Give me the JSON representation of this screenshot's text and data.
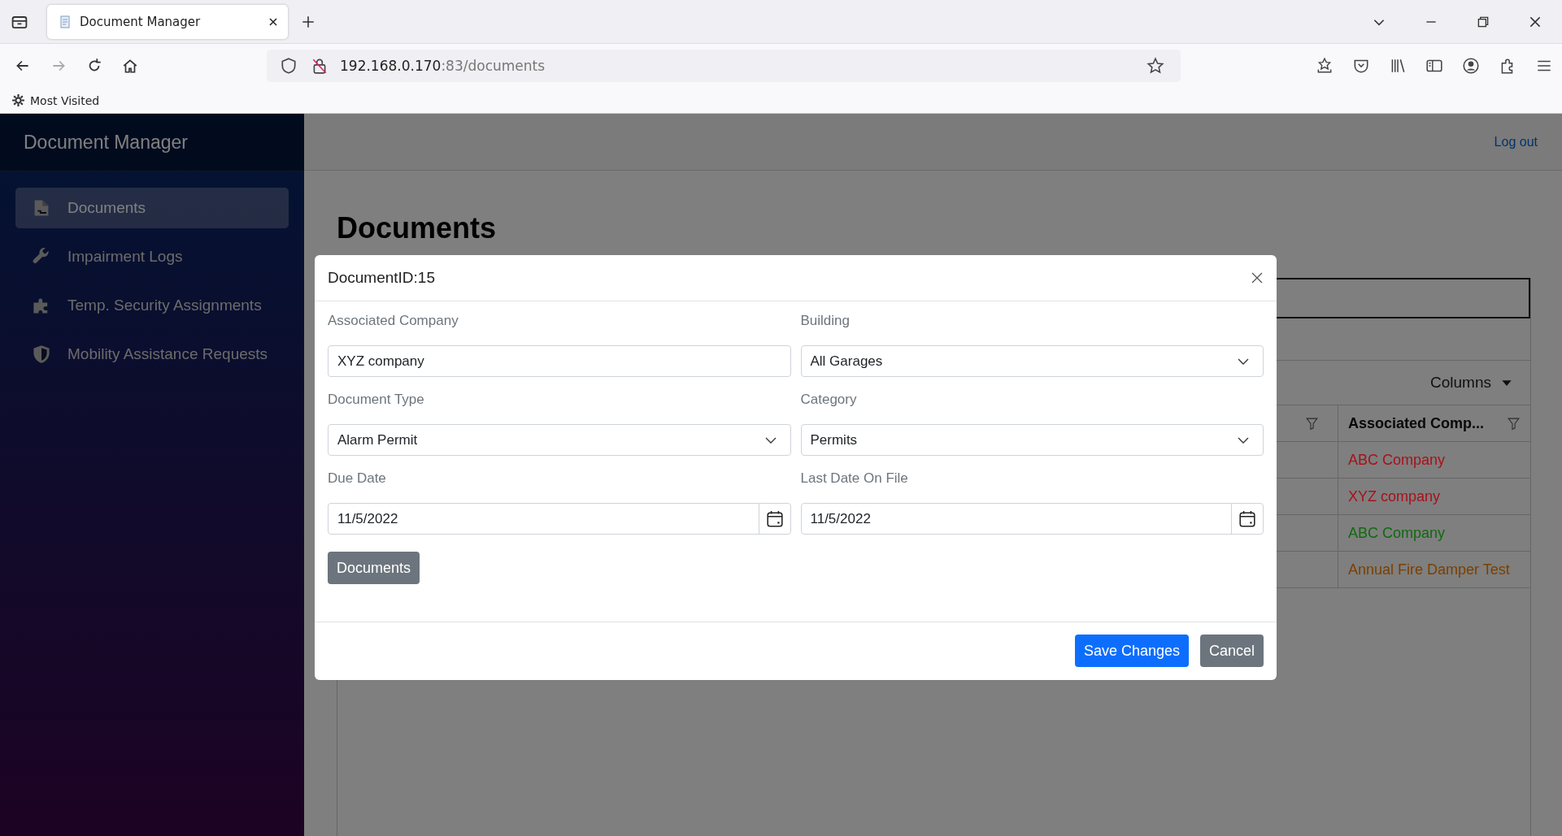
{
  "browser": {
    "tabs": [
      {
        "title": "Document Manager",
        "selected": true
      }
    ],
    "url": {
      "host": "192.168.0.170",
      "rest": ":83/documents"
    },
    "bookmarks": [
      "Most Visited"
    ]
  },
  "sidebar": {
    "brand": "Document Manager",
    "items": [
      {
        "label": "Documents",
        "selected": true
      },
      {
        "label": "Impairment Logs",
        "selected": false
      },
      {
        "label": "Temp. Security Assignments",
        "selected": false
      },
      {
        "label": "Mobility Assistance Requests",
        "selected": false
      }
    ]
  },
  "header": {
    "logout": "Log out"
  },
  "page_title": "Documents",
  "table": {
    "columns_button": "Columns",
    "column": "Associated Comp...",
    "rows": [
      {
        "text": "ABC Company",
        "color": "#a8111b"
      },
      {
        "text": "XYZ company",
        "color": "#a8111b"
      },
      {
        "text": "ABC Company",
        "color": "#0f6b0f"
      },
      {
        "text": "Annual Fire Damper Test",
        "color": "#7a4000"
      }
    ]
  },
  "modal": {
    "title": "DocumentID:15",
    "fields": [
      {
        "label": "Associated Company",
        "kind": "text",
        "value": "XYZ company"
      },
      {
        "label": "Building",
        "kind": "select",
        "value": "All Garages"
      },
      {
        "label": "Document Type",
        "kind": "select",
        "value": "Alarm Permit"
      },
      {
        "label": "Category",
        "kind": "select",
        "value": "Permits"
      },
      {
        "label": "Due Date",
        "kind": "date",
        "value": "11/5/2022"
      },
      {
        "label": "Last Date On File",
        "kind": "date",
        "value": "11/5/2022"
      }
    ],
    "documents_button": "Documents",
    "buttons": [
      {
        "label": "Save Changes",
        "kind": "primary"
      },
      {
        "label": "Cancel",
        "kind": "secondary"
      }
    ]
  }
}
